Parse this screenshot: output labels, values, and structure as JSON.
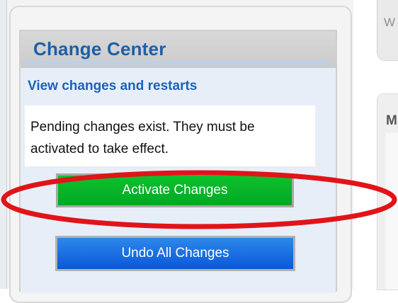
{
  "change_center": {
    "title": "Change Center",
    "subtitle": "View changes and restarts",
    "message": "Pending changes exist. They must be activated to take effect.",
    "activate_label": "Activate Changes",
    "undo_label": "Undo All Changes"
  },
  "right_panels": {
    "top_text": "W",
    "middle_text": "M"
  },
  "colors": {
    "accent_blue": "#1e5fa8",
    "activate_green": "#06b629",
    "undo_blue": "#1870e3",
    "annotation_red": "#e01419"
  }
}
